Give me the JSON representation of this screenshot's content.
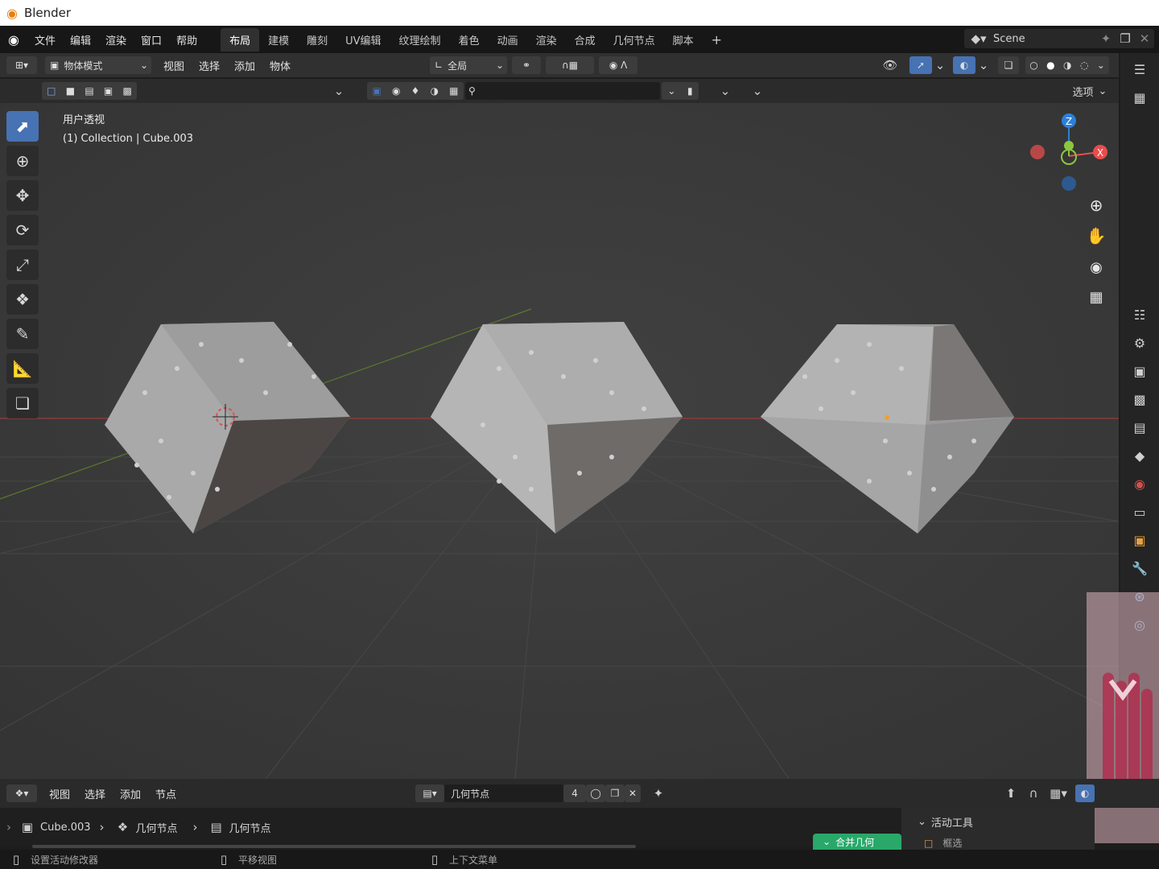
{
  "window": {
    "title": "Blender"
  },
  "menubar": {
    "menus": [
      "文件",
      "编辑",
      "渲染",
      "窗口",
      "帮助"
    ],
    "workspaces": [
      "布局",
      "建模",
      "雕刻",
      "UV编辑",
      "纹理绘制",
      "着色",
      "动画",
      "渲染",
      "合成",
      "几何节点",
      "脚本"
    ],
    "active_workspace": "布局",
    "add_tab": "+",
    "scene_name": "Scene"
  },
  "viewport_header": {
    "mode": "物体模式",
    "menus": [
      "视图",
      "选择",
      "添加",
      "物体"
    ],
    "transform_orientation": "全局",
    "options_label": "选项"
  },
  "viewport_overlay": {
    "view_name": "用户透视",
    "object_info": "(1) Collection | Cube.003"
  },
  "gizmo": {
    "z": "Z",
    "x": "X",
    "y": "Y"
  },
  "node_editor_header": {
    "menus": [
      "视图",
      "选择",
      "添加",
      "节点"
    ],
    "node_tree_name": "几何节点",
    "users_count": "4"
  },
  "breadcrumb": {
    "object": "Cube.003",
    "modifier": "几何节点",
    "node_group": "几何节点"
  },
  "node_editor": {
    "node_label": "合并几何"
  },
  "active_tool_panel": {
    "title": "活动工具",
    "tool_name": "框选"
  },
  "statusbar": {
    "items": [
      "设置活动修改器",
      "平移视图",
      "上下文菜单"
    ]
  },
  "colors": {
    "accent": "#4772b3",
    "axis_x": "#e84d4d",
    "axis_y": "#8cc63f",
    "axis_z": "#2d7fd8",
    "node_green": "#29a86a",
    "blender_orange": "#e87d0d"
  }
}
